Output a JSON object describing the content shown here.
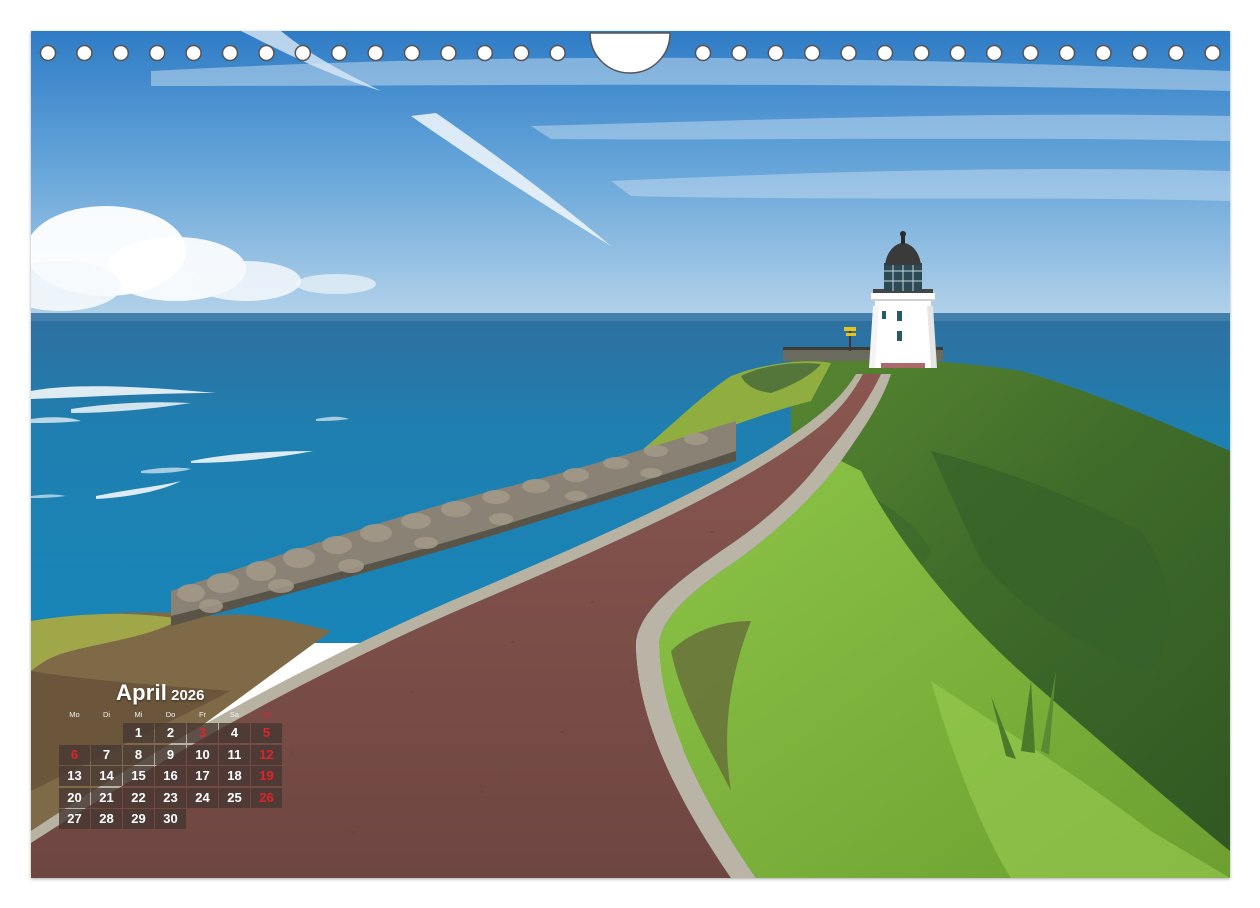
{
  "calendar": {
    "month": "April",
    "year": "2026",
    "weekdays": [
      "Mo",
      "Di",
      "Mi",
      "Do",
      "Fr",
      "Sa",
      "So"
    ],
    "leading_blank_days": 2,
    "days": [
      {
        "label": "1",
        "type": "normal"
      },
      {
        "label": "2",
        "type": "normal"
      },
      {
        "label": "3",
        "type": "holiday"
      },
      {
        "label": "4",
        "type": "normal"
      },
      {
        "label": "5",
        "type": "holiday"
      },
      {
        "label": "6",
        "type": "holiday"
      },
      {
        "label": "7",
        "type": "normal"
      },
      {
        "label": "8",
        "type": "normal"
      },
      {
        "label": "9",
        "type": "normal"
      },
      {
        "label": "10",
        "type": "normal"
      },
      {
        "label": "11",
        "type": "normal"
      },
      {
        "label": "12",
        "type": "sunday"
      },
      {
        "label": "13",
        "type": "normal"
      },
      {
        "label": "14",
        "type": "normal"
      },
      {
        "label": "15",
        "type": "normal"
      },
      {
        "label": "16",
        "type": "normal"
      },
      {
        "label": "17",
        "type": "normal"
      },
      {
        "label": "18",
        "type": "normal"
      },
      {
        "label": "19",
        "type": "sunday"
      },
      {
        "label": "20",
        "type": "normal"
      },
      {
        "label": "21",
        "type": "normal"
      },
      {
        "label": "22",
        "type": "normal"
      },
      {
        "label": "23",
        "type": "normal"
      },
      {
        "label": "24",
        "type": "normal"
      },
      {
        "label": "25",
        "type": "normal"
      },
      {
        "label": "26",
        "type": "sunday"
      },
      {
        "label": "27",
        "type": "normal"
      },
      {
        "label": "28",
        "type": "normal"
      },
      {
        "label": "29",
        "type": "normal"
      },
      {
        "label": "30",
        "type": "normal"
      }
    ]
  },
  "colors": {
    "sunday_holiday_red": "#e0242a",
    "day_cell_background": "#46372f",
    "sea": "#1f7fb0",
    "path": "#7a4f4a",
    "grass": "#7fb63a"
  }
}
